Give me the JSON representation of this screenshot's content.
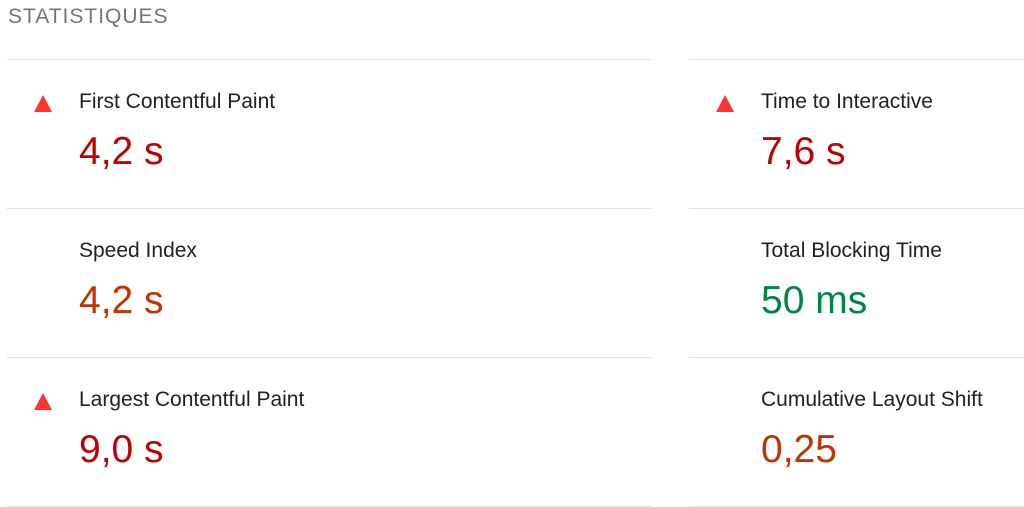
{
  "section": {
    "title": "STATISTIQUES"
  },
  "colors": {
    "fail": "#c00000",
    "average": "#c33300",
    "pass": "#018642",
    "fail_icon": "#ff3333"
  },
  "metrics": {
    "left": [
      {
        "label": "First Contentful Paint",
        "value": "4,2 s",
        "status": "fail",
        "icon": "warning-triangle-icon"
      },
      {
        "label": "Speed Index",
        "value": "4,2 s",
        "status": "average"
      },
      {
        "label": "Largest Contentful Paint",
        "value": "9,0 s",
        "status": "fail",
        "icon": "warning-triangle-icon"
      }
    ],
    "right": [
      {
        "label": "Time to Interactive",
        "value": "7,6 s",
        "status": "fail",
        "icon": "warning-triangle-icon"
      },
      {
        "label": "Total Blocking Time",
        "value": "50 ms",
        "status": "pass"
      },
      {
        "label": "Cumulative Layout Shift",
        "value": "0,25",
        "status": "average"
      }
    ]
  }
}
